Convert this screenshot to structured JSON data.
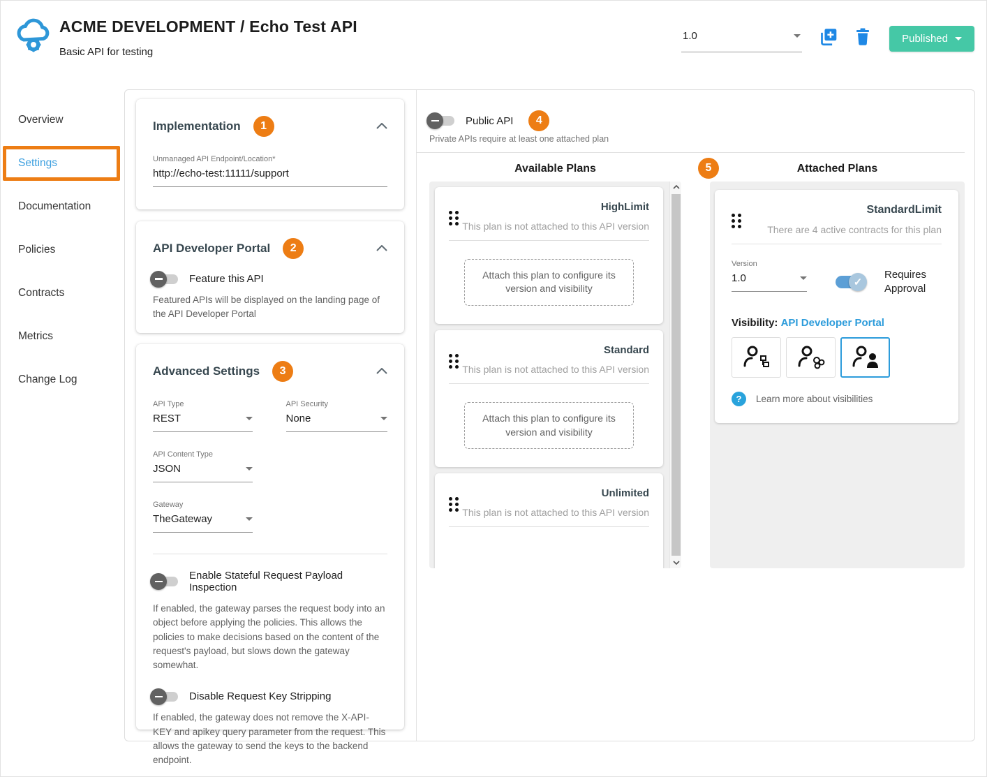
{
  "header": {
    "title": "ACME DEVELOPMENT / Echo Test API",
    "subtitle": "Basic API for testing",
    "version_value": "1.0",
    "published_label": "Published"
  },
  "sidebar": {
    "items": [
      {
        "label": "Overview"
      },
      {
        "label": "Settings"
      },
      {
        "label": "Documentation"
      },
      {
        "label": "Policies"
      },
      {
        "label": "Contracts"
      },
      {
        "label": "Metrics"
      },
      {
        "label": "Change Log"
      }
    ]
  },
  "implementation": {
    "title": "Implementation",
    "badge": "1",
    "endpoint_label": "Unmanaged API Endpoint/Location*",
    "endpoint_value": "http://echo-test:11111/support"
  },
  "developer_portal": {
    "title": "API Developer Portal",
    "badge": "2",
    "toggle_label": "Feature this API",
    "description": "Featured APIs will be displayed on the landing page of the API Developer Portal"
  },
  "advanced": {
    "title": "Advanced Settings",
    "badge": "3",
    "fields": [
      {
        "label": "API Type",
        "value": "REST"
      },
      {
        "label": "API Security",
        "value": "None"
      },
      {
        "label": "API Content Type",
        "value": "JSON"
      },
      {
        "label": "Gateway",
        "value": "TheGateway"
      }
    ],
    "toggles": [
      {
        "label": "Enable Stateful Request Payload Inspection",
        "description": "If enabled, the gateway parses the request body into an object before applying the policies. This allows the policies to make decisions based on the content of the request's payload, but slows down the gateway somewhat."
      },
      {
        "label": "Disable Request Key Stripping",
        "description": "If enabled, the gateway does not remove the X-API-KEY and apikey query parameter from the request. This allows the gateway to send the keys to the backend endpoint."
      }
    ]
  },
  "plans": {
    "public_toggle_label": "Public API",
    "public_badge": "4",
    "private_note": "Private APIs require at least one attached plan",
    "available_title": "Available Plans",
    "columns_badge": "5",
    "attached_title": "Attached Plans",
    "available": [
      {
        "name": "HighLimit",
        "status": "This plan is not attached to this API version",
        "action": "Attach this plan to configure its version and visibility"
      },
      {
        "name": "Standard",
        "status": "This plan is not attached to this API version",
        "action": "Attach this plan to configure its version and visibility"
      },
      {
        "name": "Unlimited",
        "status": "This plan is not attached to this API version"
      }
    ],
    "attached": {
      "name": "StandardLimit",
      "status": "There are 4 active contracts for this plan",
      "version_label": "Version",
      "version_value": "1.0",
      "approval_label": "Requires Approval",
      "visibility_label": "Visibility:",
      "visibility_value": "API Developer Portal",
      "learn_more": "Learn more about visibilities"
    }
  },
  "colors": {
    "annotation_orange": "#ed7d14",
    "link_blue": "#2d9cdb",
    "published_teal": "#45c8a6",
    "header_icon_blue": "#1e88e5",
    "toggle_on_blue": "#5c9fd6"
  }
}
